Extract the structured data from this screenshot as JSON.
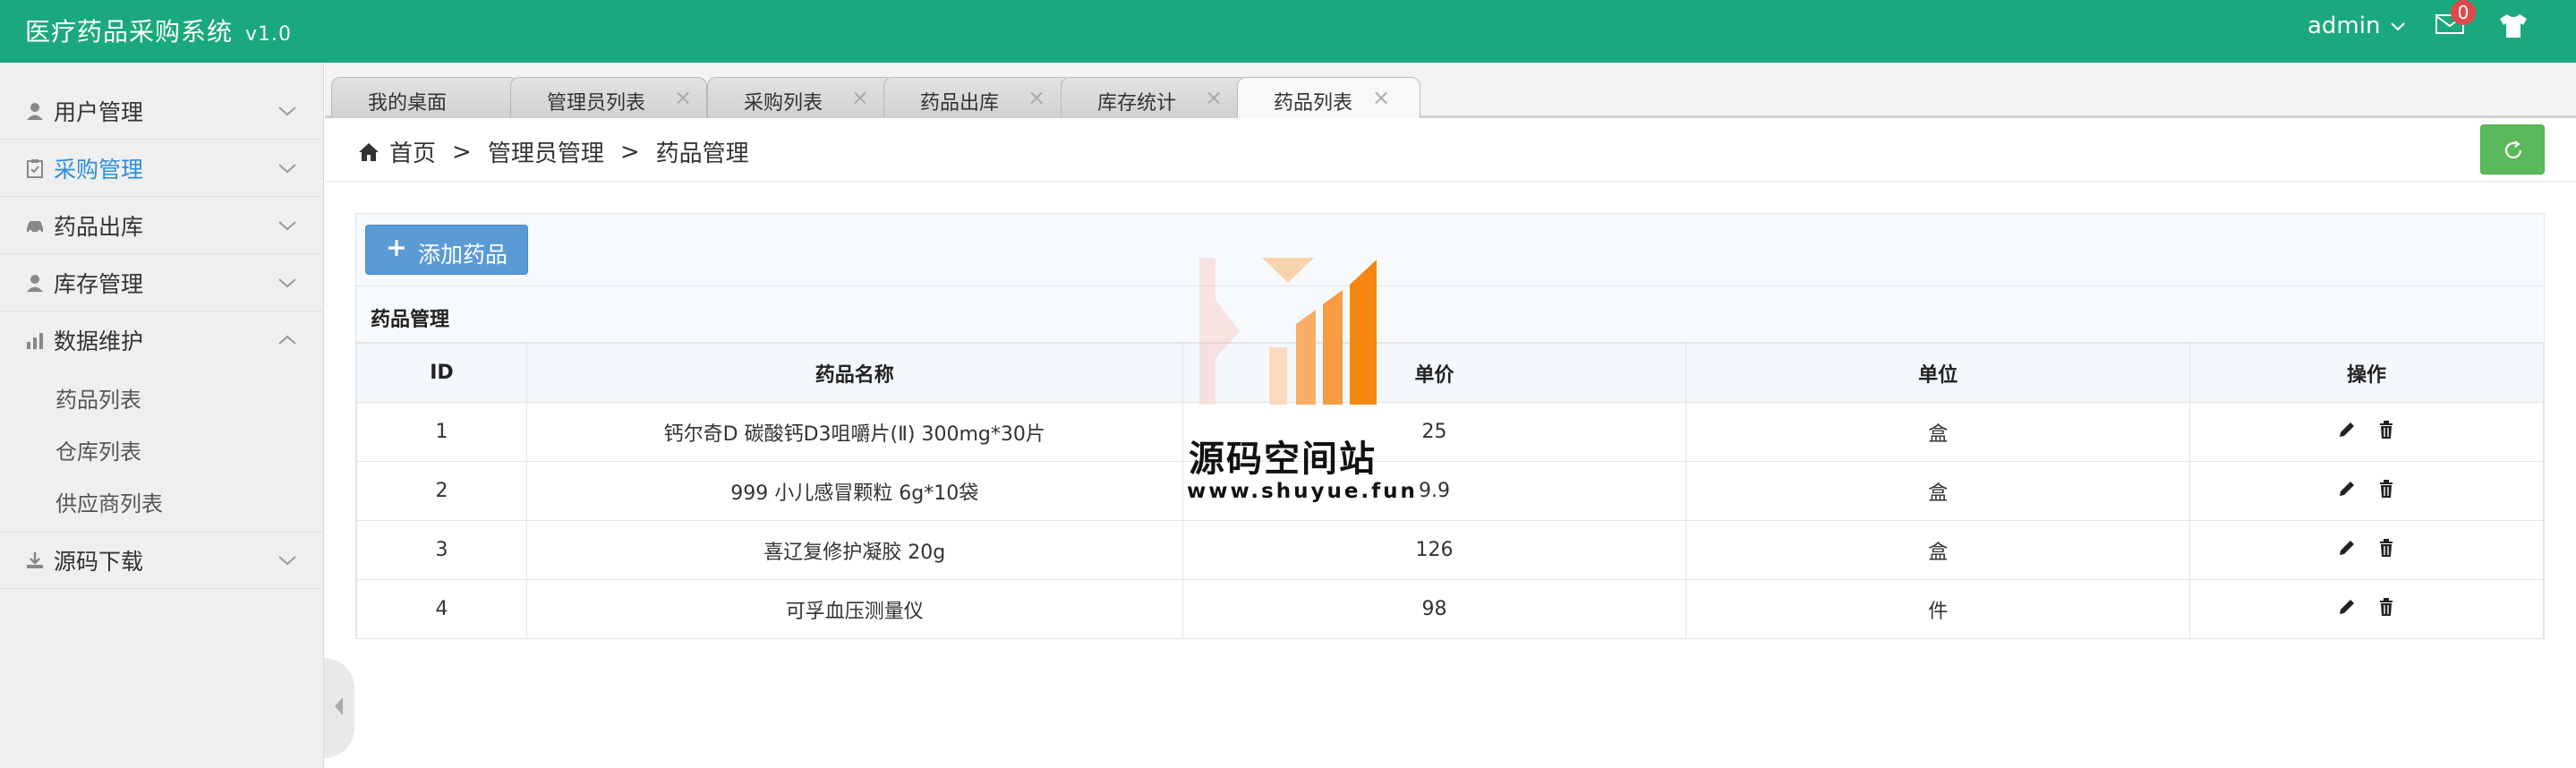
{
  "header": {
    "title": "医疗药品采购系统",
    "version": "v1.0",
    "user": "admin",
    "mail_count": "0",
    "accent": "#1aa97c"
  },
  "sidebar": {
    "items": [
      {
        "label": "用户管理",
        "icon": "user-icon"
      },
      {
        "label": "采购管理",
        "icon": "clipboard-icon",
        "active": true
      },
      {
        "label": "药品出库",
        "icon": "car-icon"
      },
      {
        "label": "库存管理",
        "icon": "user-icon"
      },
      {
        "label": "数据维护",
        "icon": "bar-chart-icon",
        "expanded": true
      },
      {
        "label": "源码下载",
        "icon": "download-icon"
      }
    ],
    "subitems": [
      "药品列表",
      "仓库列表",
      "供应商列表"
    ]
  },
  "tabs": [
    {
      "label": "我的桌面"
    },
    {
      "label": "管理员列表"
    },
    {
      "label": "采购列表"
    },
    {
      "label": "药品出库"
    },
    {
      "label": "库存统计"
    },
    {
      "label": "药品列表",
      "active": true
    }
  ],
  "breadcrumb": {
    "home": "首页",
    "level1": "管理员管理",
    "level2": "药品管理",
    "separator": ">"
  },
  "panel": {
    "add_button": "添加药品",
    "table_title": "药品管理",
    "columns": [
      "ID",
      "药品名称",
      "单价",
      "单位",
      "操作"
    ],
    "rows": [
      {
        "id": "1",
        "name": "钙尔奇D 碳酸钙D3咀嚼片(Ⅱ) 300mg*30片",
        "price": "25",
        "unit": "盒"
      },
      {
        "id": "2",
        "name": "999 小儿感冒颗粒 6g*10袋",
        "price": "9.9",
        "unit": "盒"
      },
      {
        "id": "3",
        "name": "喜辽复修护凝胶 20g",
        "price": "126",
        "unit": "盒"
      },
      {
        "id": "4",
        "name": "可孚血压测量仪",
        "price": "98",
        "unit": "件"
      }
    ]
  },
  "watermark": {
    "text": "源码空间站",
    "url": "www.shuyue.fun"
  }
}
